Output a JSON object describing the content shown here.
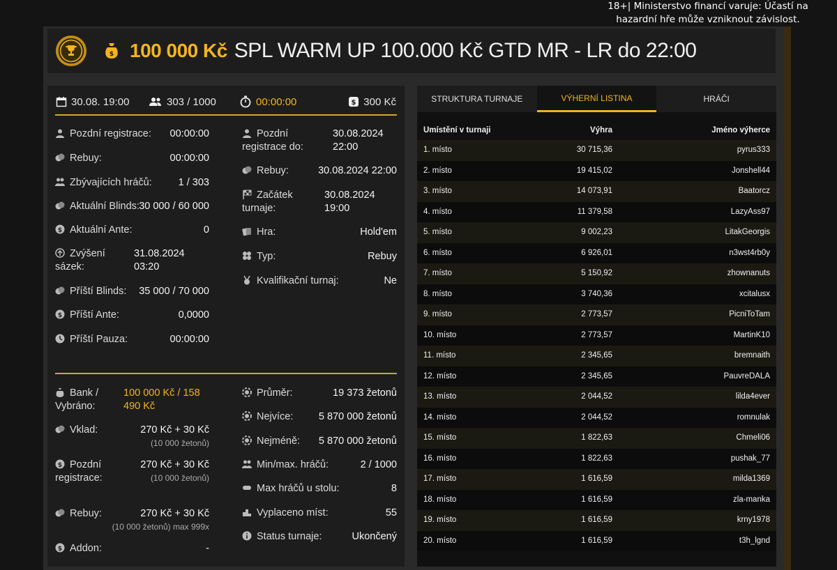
{
  "warning": "18+| Ministerstvo financí varuje: Účastí na hazardní hře může vzniknout závislost.",
  "header": {
    "prize": "100 000 Kč",
    "tournament_name": "SPL WARM UP 100.000 Kč GTD MR - LR do 22:00"
  },
  "stats": {
    "date": "30.08. 19:00",
    "players": "303 / 1000",
    "timer": "00:00:00",
    "buyin": "300 Kč"
  },
  "info_left": [
    {
      "label": "Pozdní registrace:",
      "value": "00:00:00"
    },
    {
      "label": "Rebuy:",
      "value": "00:00:00"
    },
    {
      "label": "Zbývajících hráčů:",
      "value": "1 / 303"
    },
    {
      "label": "Aktuální Blinds:",
      "value": "30 000 / 60 000"
    },
    {
      "label": "Aktuální Ante:",
      "value": "0"
    },
    {
      "label": "Zvýšení sázek:",
      "value": "31.08.2024 03:20"
    },
    {
      "label": "Příští Blinds:",
      "value": "35 000 / 70 000"
    },
    {
      "label": "Příští Ante:",
      "value": "0,0000"
    },
    {
      "label": "Příští Pauza:",
      "value": "00:00:00"
    }
  ],
  "info_right": [
    {
      "label": "Pozdní registrace do:",
      "value": "30.08.2024 22:00"
    },
    {
      "label": "Rebuy:",
      "value": "30.08.2024 22:00"
    },
    {
      "label": "Začátek turnaje:",
      "value": "30.08.2024 19:00"
    },
    {
      "label": "Hra:",
      "value": "Hold'em"
    },
    {
      "label": "Typ:",
      "value": "Rebuy"
    },
    {
      "label": "Kvalifikační turnaj:",
      "value": "Ne"
    }
  ],
  "bank": {
    "label": "Bank / Vybráno:",
    "value": "100 000 Kč / 158 490 Kč"
  },
  "fees": [
    {
      "label": "Vklad:",
      "value": "270 Kč + 30 Kč",
      "sub": "(10 000 žetonů)"
    },
    {
      "label": "Pozdní registrace:",
      "value": "270 Kč + 30 Kč",
      "sub": "(10 000 žetonů)"
    },
    {
      "label": "Rebuy:",
      "value": "270 Kč + 30 Kč",
      "sub": "(10 000 žetonů) max 999x"
    },
    {
      "label": "Addon:",
      "value": "-",
      "sub": ""
    }
  ],
  "chips": [
    {
      "label": "Průměr:",
      "value": "19 373 žetonů"
    },
    {
      "label": "Nejvíce:",
      "value": "5 870 000 žetonů"
    },
    {
      "label": "Nejméně:",
      "value": "5 870 000 žetonů"
    },
    {
      "label": "Min/max. hráčů:",
      "value": "2 / 1000"
    },
    {
      "label": "Max hráčů u stolu:",
      "value": "8"
    },
    {
      "label": "Vyplaceno míst:",
      "value": "55"
    },
    {
      "label": "Status turnaje:",
      "value": "Ukončený"
    }
  ],
  "tabs": [
    "STRUKTURA TURNAJE",
    "VÝHERNÍ LISTINA",
    "HRÁČI"
  ],
  "table": {
    "headers": [
      "Umístění v turnaji",
      "Výhra",
      "Jméno výherce"
    ],
    "rows": [
      [
        "1. místo",
        "30 715,36",
        "pyrus333"
      ],
      [
        "2. místo",
        "19 415,02",
        "Jonshell44"
      ],
      [
        "3. místo",
        "14 073,91",
        "Baatorcz"
      ],
      [
        "4. místo",
        "11 379,58",
        "LazyAss97"
      ],
      [
        "5. místo",
        "9 002,23",
        "LitakGeorgis"
      ],
      [
        "6. místo",
        "6 926,01",
        "n3wst4rb0y"
      ],
      [
        "7. místo",
        "5 150,92",
        "zhownanuts"
      ],
      [
        "8. místo",
        "3 740,36",
        "xcitalusx"
      ],
      [
        "9. místo",
        "2 773,57",
        "PicniToTam"
      ],
      [
        "10. místo",
        "2 773,57",
        "MartinK10"
      ],
      [
        "11. místo",
        "2 345,65",
        "bremnaith"
      ],
      [
        "12. místo",
        "2 345,65",
        "PauvreDALA"
      ],
      [
        "13. místo",
        "2 044,52",
        "lilda4ever"
      ],
      [
        "14. místo",
        "2 044,52",
        "romnulak"
      ],
      [
        "15. místo",
        "1 822,63",
        "Chmeli06"
      ],
      [
        "16. místo",
        "1 822,63",
        "pushak_77"
      ],
      [
        "17. místo",
        "1 616,59",
        "milda1369"
      ],
      [
        "18. místo",
        "1 616,59",
        "zla-manka"
      ],
      [
        "19. místo",
        "1 616,59",
        "krny1978"
      ],
      [
        "20. místo",
        "1 616,59",
        "t3h_lgnd"
      ]
    ]
  }
}
